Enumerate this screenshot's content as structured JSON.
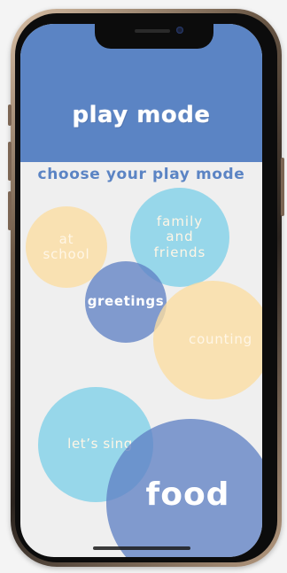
{
  "header": {
    "title": "play mode"
  },
  "subtitle": "choose your play mode",
  "modes": [
    {
      "label": "at\nschool",
      "color": "yellow"
    },
    {
      "label": "family\nand\nfriends",
      "color": "cyan"
    },
    {
      "label": "greetings",
      "color": "blue"
    },
    {
      "label": "counting",
      "color": "yellow"
    },
    {
      "label": "let’s sing",
      "color": "cyan"
    },
    {
      "label": "food",
      "color": "blue"
    }
  ],
  "colors": {
    "header": "#5b84c4",
    "yellow": "#fbdda0",
    "cyan": "#7dd0e8",
    "blue": "#6082c4",
    "background": "#efefef"
  }
}
